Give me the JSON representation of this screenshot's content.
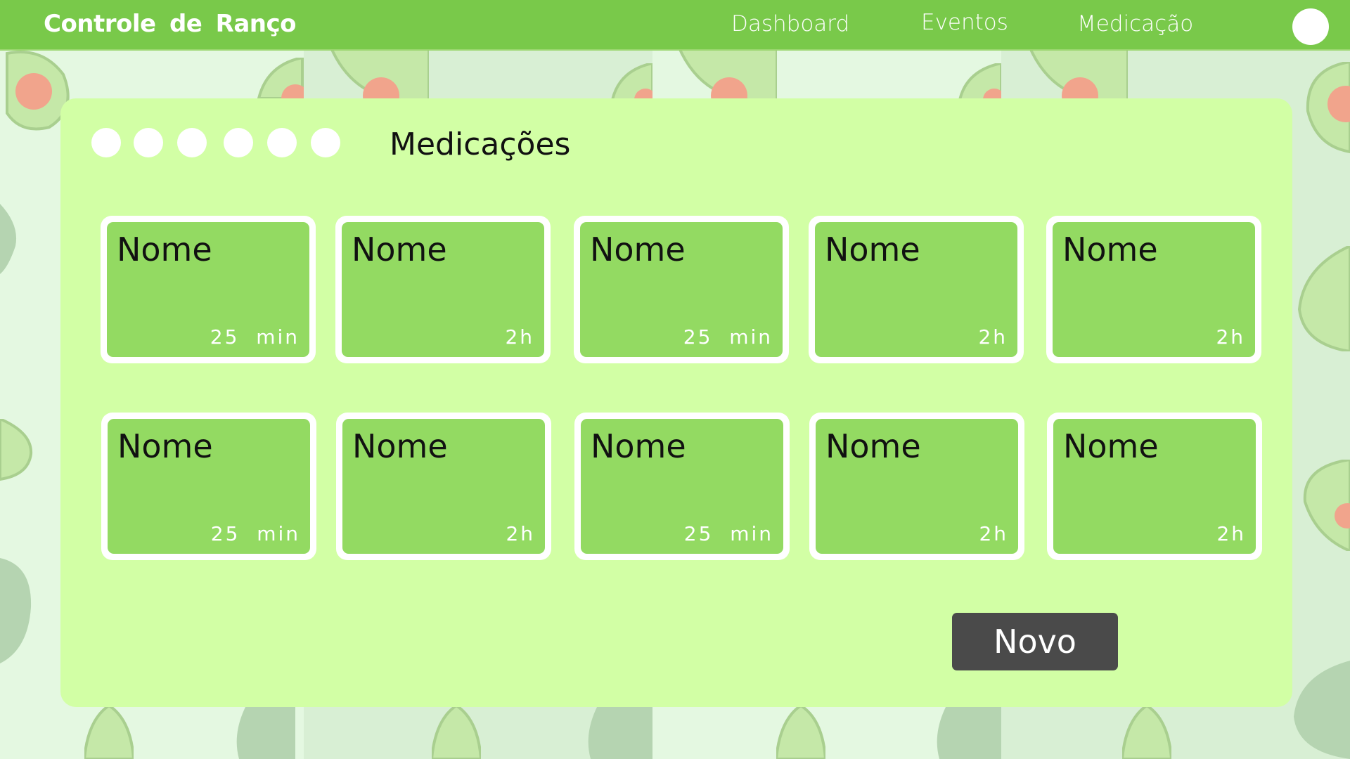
{
  "app": {
    "title": "Controle de Ranço",
    "nav": [
      "Dashboard",
      "Eventos",
      "Medicação"
    ]
  },
  "panel": {
    "title": "Medicações",
    "cards": [
      {
        "name": "Nome",
        "duration": "25  min"
      },
      {
        "name": "Nome",
        "duration": "2h"
      },
      {
        "name": "Nome",
        "duration": "25  min"
      },
      {
        "name": "Nome",
        "duration": "2h"
      },
      {
        "name": "Nome",
        "duration": "2h"
      },
      {
        "name": "Nome",
        "duration": "25  min"
      },
      {
        "name": "Nome",
        "duration": "2h"
      },
      {
        "name": "Nome",
        "duration": "25  min"
      },
      {
        "name": "Nome",
        "duration": "2h"
      },
      {
        "name": "Nome",
        "duration": "2h"
      }
    ],
    "new_button": "Novo"
  },
  "colors": {
    "topbar": "#79c94a",
    "panel": "#d2ffa5",
    "card": "#93da62",
    "button": "#4a4a4a"
  },
  "icons": [
    "avatar-circle",
    "step-dot",
    "avocado-decoration"
  ]
}
